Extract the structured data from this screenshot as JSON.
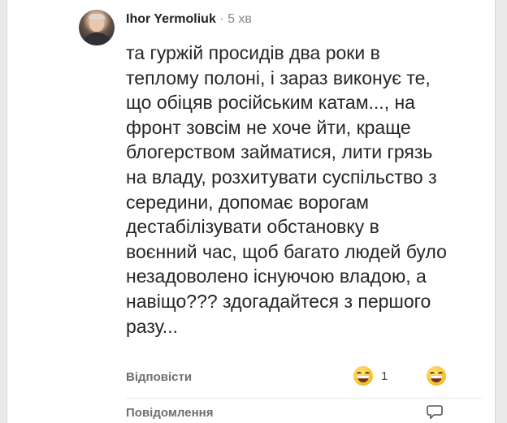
{
  "comment": {
    "author": "Ihor Yermoliuk",
    "separator": " · ",
    "time": "5 хв",
    "lines": [
      "та гуржій просидів два роки в",
      "теплому полоні, і зараз виконує те,",
      "що обіцяв російським катам..., на",
      "фронт зовсім не хоче йти, краще",
      "блогерством займатися, лити грязь",
      "на владу, розхитувати суспільство з",
      "середини, допомає ворогам",
      "дестабілізувати обстановку в",
      "воєнний час, щоб багато людей було",
      "незадоволено існуючою владою, а",
      "навіщо??? здогадайтеся з першого",
      "разу..."
    ]
  },
  "actions": {
    "reply_label": "Відповісти",
    "message_label": "Повідомлення"
  },
  "reactions": {
    "laugh": {
      "icon": "laughing-face-emoji",
      "count": "1"
    },
    "add_reaction": {
      "icon": "add-reaction-emoji"
    }
  },
  "icons": {
    "avatar": "user-avatar",
    "message": "message-bubble-icon"
  },
  "colors": {
    "background": "#e9e9e9",
    "card": "#ffffff",
    "text": "#262626",
    "muted": "#8a8a8a",
    "emoji": "#f7c531"
  }
}
